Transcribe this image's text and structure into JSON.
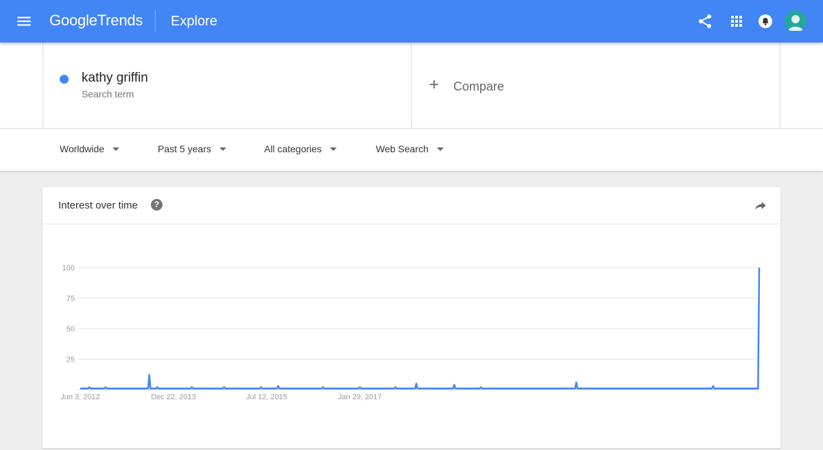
{
  "header": {
    "logo_google": "Google",
    "logo_trends": "Trends",
    "page": "Explore",
    "icons": [
      "menu-icon",
      "share-icon",
      "apps-icon",
      "notification-icon",
      "avatar"
    ],
    "bar_color": "#4285f4"
  },
  "search": {
    "term": "kathy griffin",
    "term_subtitle": "Search term",
    "term_color": "#4285f4",
    "compare_symbol": "+",
    "compare_label": "Compare"
  },
  "filters": {
    "region": "Worldwide",
    "time": "Past 5 years",
    "category": "All categories",
    "property": "Web Search"
  },
  "card": {
    "title": "Interest over time",
    "help_symbol": "?"
  },
  "chart_data": {
    "type": "line",
    "title": "Interest over time",
    "ylim": [
      0,
      100
    ],
    "y_ticks": [
      100,
      75,
      50,
      25
    ],
    "x_tick_labels": [
      "Jun 3, 2012",
      "Dec 22, 2013",
      "Jul 12, 2015",
      "Jan 29, 2017"
    ],
    "grid": true,
    "x_start": "2012-06-03",
    "x_step_days": 7,
    "series": [
      {
        "color": "#4285f4",
        "values": [
          1,
          1,
          1,
          1,
          1,
          1,
          1,
          1,
          2,
          1,
          1,
          1,
          1,
          1,
          1,
          1,
          1,
          1,
          1,
          1,
          1,
          1,
          2,
          1,
          1,
          1,
          1,
          1,
          1,
          1,
          1,
          1,
          1,
          1,
          1,
          1,
          1,
          1,
          1,
          1,
          1,
          1,
          1,
          1,
          1,
          1,
          1,
          1,
          1,
          1,
          1,
          1,
          1,
          1,
          1,
          1,
          1,
          1,
          1,
          1,
          12,
          1,
          1,
          1,
          1,
          1,
          1,
          2,
          1,
          1,
          1,
          1,
          1,
          1,
          1,
          1,
          1,
          1,
          1,
          1,
          1,
          1,
          1,
          1,
          1,
          1,
          1,
          1,
          1,
          1,
          1,
          1,
          1,
          1,
          1,
          1,
          1,
          2,
          1,
          1,
          1,
          1,
          1,
          1,
          1,
          1,
          1,
          1,
          1,
          1,
          1,
          1,
          1,
          1,
          1,
          1,
          1,
          1,
          1,
          1,
          1,
          1,
          1,
          1,
          1,
          2,
          1,
          1,
          1,
          1,
          1,
          1,
          1,
          1,
          1,
          1,
          1,
          1,
          1,
          1,
          1,
          1,
          1,
          1,
          1,
          1,
          1,
          1,
          1,
          1,
          1,
          1,
          1,
          1,
          1,
          1,
          1,
          2,
          1,
          1,
          1,
          1,
          1,
          1,
          1,
          1,
          1,
          1,
          1,
          1,
          1,
          1,
          3,
          1,
          1,
          1,
          1,
          1,
          1,
          1,
          1,
          1,
          1,
          1,
          1,
          1,
          1,
          1,
          1,
          1,
          1,
          1,
          1,
          1,
          1,
          1,
          1,
          1,
          1,
          1,
          1,
          1,
          1,
          1,
          1,
          1,
          1,
          1,
          1,
          1,
          1,
          2,
          1,
          1,
          1,
          1,
          1,
          1,
          1,
          1,
          1,
          1,
          1,
          1,
          1,
          1,
          1,
          1,
          1,
          1,
          1,
          1,
          1,
          1,
          1,
          1,
          1,
          1,
          1,
          1,
          1,
          1,
          1,
          2,
          1,
          1,
          1,
          1,
          1,
          1,
          1,
          1,
          1,
          1,
          1,
          1,
          1,
          1,
          1,
          1,
          1,
          1,
          1,
          1,
          1,
          1,
          1,
          1,
          1,
          1,
          1,
          1,
          1,
          1,
          2,
          1,
          1,
          1,
          1,
          1,
          1,
          1,
          1,
          1,
          1,
          1,
          1,
          1,
          1,
          1,
          1,
          1,
          5,
          1,
          1,
          1,
          1,
          1,
          1,
          1,
          1,
          1,
          1,
          1,
          1,
          1,
          1,
          1,
          1,
          1,
          1,
          1,
          1,
          1,
          1,
          1,
          1,
          1,
          1,
          1,
          1,
          1,
          1,
          1,
          1,
          4,
          1,
          1,
          1,
          1,
          1,
          1,
          1,
          1,
          1,
          1,
          1,
          1,
          1,
          1,
          1,
          1,
          1,
          1,
          1,
          1,
          1,
          1,
          2,
          1,
          1,
          1,
          1,
          1,
          1,
          1,
          1,
          1,
          1,
          1,
          1,
          1,
          1,
          1,
          1,
          1,
          1,
          1,
          1,
          1,
          1,
          1,
          1,
          1,
          1,
          1,
          1,
          1,
          1,
          1,
          1,
          1,
          1,
          1,
          1,
          1,
          1,
          1,
          1,
          1,
          1,
          1,
          1,
          1,
          1,
          1,
          1,
          1,
          1,
          1,
          1,
          1,
          1,
          1,
          1,
          1,
          1,
          1,
          1,
          1,
          1,
          1,
          1,
          1,
          1,
          1,
          1,
          1,
          1,
          1,
          1,
          1,
          1,
          1,
          1,
          1,
          1,
          1,
          1,
          1,
          1,
          6,
          1,
          1,
          1,
          1,
          1,
          1,
          1,
          1,
          1,
          1,
          1,
          1,
          1,
          1,
          1,
          1,
          1,
          1,
          1,
          1,
          1,
          1,
          1,
          1,
          1,
          1,
          1,
          1,
          1,
          1,
          1,
          1,
          1,
          1,
          1,
          1,
          1,
          1,
          1,
          1,
          1,
          1,
          1,
          1,
          1,
          1,
          1,
          1,
          1,
          1,
          1,
          1,
          1,
          1,
          1,
          1,
          1,
          1,
          1,
          1,
          1,
          1,
          1,
          1,
          1,
          1,
          1,
          1,
          1,
          1,
          1,
          1,
          1,
          1,
          1,
          1,
          1,
          1,
          1,
          1,
          1,
          1,
          1,
          1,
          1,
          1,
          1,
          1,
          1,
          1,
          1,
          1,
          1,
          1,
          1,
          1,
          1,
          1,
          1,
          1,
          1,
          1,
          1,
          1,
          1,
          1,
          1,
          1,
          1,
          1,
          1,
          1,
          1,
          1,
          1,
          1,
          1,
          1,
          3,
          1,
          1,
          1,
          1,
          1,
          1,
          1,
          1,
          1,
          1,
          1,
          1,
          1,
          1,
          1,
          1,
          1,
          1,
          1,
          1,
          1,
          1,
          1,
          1,
          1,
          1,
          1,
          1,
          1,
          1,
          1,
          1,
          1,
          1,
          1,
          1,
          1,
          1,
          1,
          100
        ]
      }
    ]
  }
}
